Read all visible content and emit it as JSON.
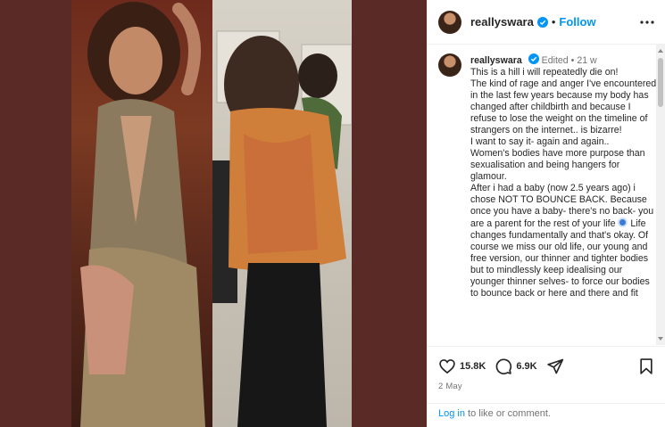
{
  "header": {
    "username": "reallyswara",
    "separator": "•",
    "follow_label": "Follow"
  },
  "caption": {
    "username": "reallyswara",
    "edited": "Edited",
    "separator": "•",
    "age": "21 w",
    "text_part1": "This is a hill i will repeatedly die on!\nThe kind of rage and anger I've encountered in the last few years because my body has changed after childbirth and because I refuse to lose the weight on the timeline of strangers on the internet.. is bizarre!\nI want to say it- again and again..\nWomen's bodies have more purpose than sexualisation and being hangers for glamour.\nAfter i had a baby (now 2.5 years ago) i chose NOT TO BOUNCE BACK. Because once you have a baby- there's no back- you are a parent for the rest of your life ",
    "text_part2": " Life changes fundamentally and that's okay. Of course we miss our old life, our young and free version, our thinner and tighter bodies but to mindlessly keep idealising our younger thinner selves- to force our bodies to bounce back or here and there and fit"
  },
  "actions": {
    "likes": "15.8K",
    "comments": "6.9K",
    "date": "2 May"
  },
  "footer": {
    "login_label": "Log in",
    "rest": " to like or comment."
  },
  "icons": {
    "verified": "verified-badge-icon",
    "more": "more-options-icon",
    "like": "heart-icon",
    "comment": "comment-icon",
    "share": "share-icon",
    "save": "bookmark-icon",
    "emoji": "nazar-amulet-emoji"
  },
  "colors": {
    "accent": "#0095f6",
    "media_background": "#5a2a26"
  }
}
